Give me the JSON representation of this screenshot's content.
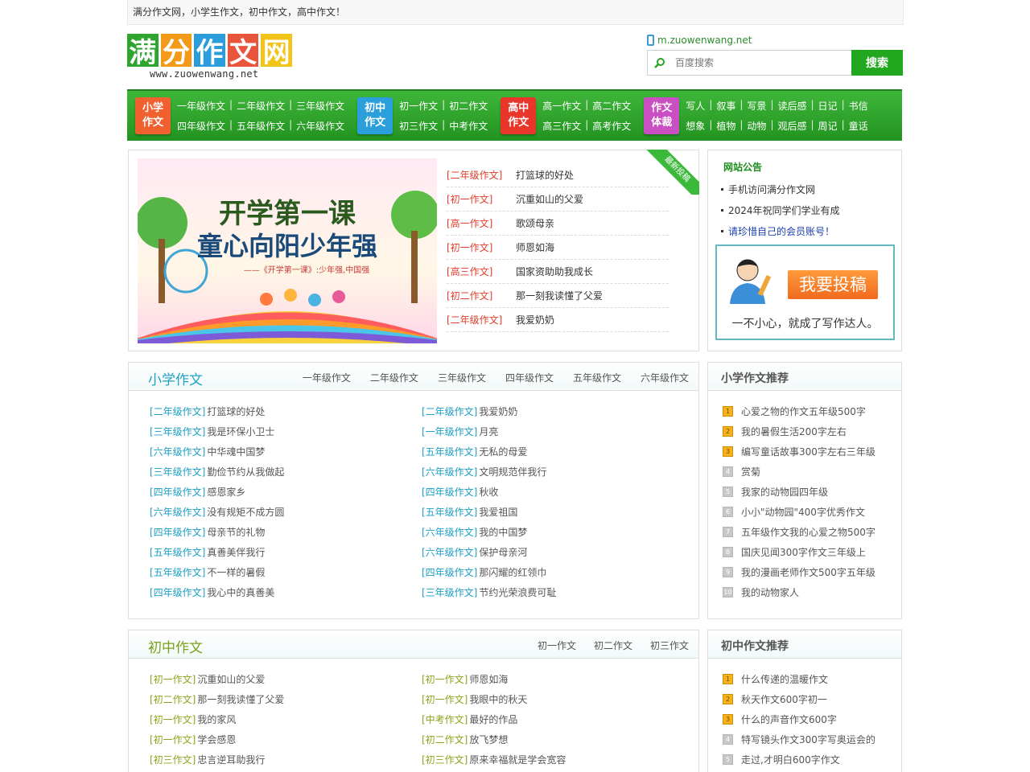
{
  "topbar": {
    "text": "满分作文网，小学生作文，初中作文，高中作文！"
  },
  "logo": {
    "chars": [
      "满",
      "分",
      "作",
      "文",
      "网"
    ],
    "colors": [
      "#2fa52f",
      "#f39a1b",
      "#2c9ddb",
      "#e9553a",
      "#f2c318"
    ],
    "url": "www.zuowenwang.net"
  },
  "header": {
    "mobile_link": "m.zuowenwang.net",
    "search_placeholder": "百度搜索",
    "search_button": "搜索"
  },
  "nav": [
    {
      "badge": [
        "小学",
        "作文"
      ],
      "color": "#f0612f",
      "rows": [
        [
          "一年级作文",
          "二年级作文",
          "三年级作文"
        ],
        [
          "四年级作文",
          "五年级作文",
          "六年级作文"
        ]
      ]
    },
    {
      "badge": [
        "初中",
        "作文"
      ],
      "color": "#2a9fdc",
      "rows": [
        [
          "初一作文",
          "初二作文"
        ],
        [
          "初三作文",
          "中考作文"
        ]
      ]
    },
    {
      "badge": [
        "高中",
        "作文"
      ],
      "color": "#e8362b",
      "rows": [
        [
          "高一作文",
          "高二作文"
        ],
        [
          "高三作文",
          "高考作文"
        ]
      ]
    },
    {
      "badge": [
        "作文",
        "体裁"
      ],
      "color": "#c94fc2",
      "rows": [
        [
          "写人",
          "叙事",
          "写景",
          "读后感",
          "日记",
          "书信"
        ],
        [
          "想象",
          "植物",
          "动物",
          "观后感",
          "周记",
          "童话"
        ]
      ]
    }
  ],
  "banner": {
    "line1": "开学第一课",
    "line2": "童心向阳少年强",
    "caption": "——《开学第一课》:少年强,中国强"
  },
  "latest": {
    "ribbon": "最新投稿",
    "items": [
      {
        "cat": "[二年级作文]",
        "title": "打篮球的好处"
      },
      {
        "cat": "[初一作文]",
        "title": "沉重如山的父爱"
      },
      {
        "cat": "[高一作文]",
        "title": "歌颂母亲"
      },
      {
        "cat": "[初一作文]",
        "title": "师恩如海"
      },
      {
        "cat": "[高三作文]",
        "title": "国家资助助我成长"
      },
      {
        "cat": "[初二作文]",
        "title": "那一刻我读懂了父爱"
      },
      {
        "cat": "[二年级作文]",
        "title": "我爱奶奶"
      }
    ]
  },
  "notice": {
    "title": "网站公告",
    "items": [
      "手机访问满分作文网",
      "2024年祝同学们学业有成",
      "请珍惜自己的会员账号！"
    ]
  },
  "submit": {
    "button": "我要投稿",
    "slogan": "一不小心，就成了写作达人。"
  },
  "primary": {
    "title": "小学作文",
    "tabs": [
      "一年级作文",
      "二年级作文",
      "三年级作文",
      "四年级作文",
      "五年级作文",
      "六年级作文"
    ],
    "left": [
      {
        "cat": "[二年级作文]",
        "title": "打篮球的好处"
      },
      {
        "cat": "[三年级作文]",
        "title": "我是环保小卫士"
      },
      {
        "cat": "[六年级作文]",
        "title": "中华魂中国梦"
      },
      {
        "cat": "[三年级作文]",
        "title": "勤俭节约从我做起"
      },
      {
        "cat": "[四年级作文]",
        "title": "感恩家乡"
      },
      {
        "cat": "[六年级作文]",
        "title": "没有规矩不成方圆"
      },
      {
        "cat": "[四年级作文]",
        "title": "母亲节的礼物"
      },
      {
        "cat": "[五年级作文]",
        "title": "真善美伴我行"
      },
      {
        "cat": "[五年级作文]",
        "title": "不一样的暑假"
      },
      {
        "cat": "[四年级作文]",
        "title": "我心中的真善美"
      }
    ],
    "right": [
      {
        "cat": "[二年级作文]",
        "title": "我爱奶奶"
      },
      {
        "cat": "[一年级作文]",
        "title": "月亮"
      },
      {
        "cat": "[五年级作文]",
        "title": "无私的母爱"
      },
      {
        "cat": "[六年级作文]",
        "title": "文明规范伴我行"
      },
      {
        "cat": "[四年级作文]",
        "title": "秋收"
      },
      {
        "cat": "[五年级作文]",
        "title": "我爱祖国"
      },
      {
        "cat": "[六年级作文]",
        "title": "我的中国梦"
      },
      {
        "cat": "[六年级作文]",
        "title": "保护母亲河"
      },
      {
        "cat": "[四年级作文]",
        "title": "那闪耀的红领巾"
      },
      {
        "cat": "[三年级作文]",
        "title": "节约光荣浪费可耻"
      }
    ]
  },
  "primary_rec": {
    "title": "小学作文推荐",
    "items": [
      "心爱之物的作文五年级500字",
      "我的暑假生活200字左右",
      "编写童话故事300字左右三年级",
      "赏菊",
      "我家的动物园四年级",
      "小小\"动物园\"400字优秀作文",
      "五年级作文我的心爱之物500字",
      "国庆见闻300字作文三年级上",
      "我的漫画老师作文500字五年级",
      "我的动物家人"
    ]
  },
  "middle": {
    "title": "初中作文",
    "tabs": [
      "初一作文",
      "初二作文",
      "初三作文"
    ],
    "left": [
      {
        "cat": "[初一作文]",
        "title": "沉重如山的父爱"
      },
      {
        "cat": "[初二作文]",
        "title": "那一刻我读懂了父爱"
      },
      {
        "cat": "[初一作文]",
        "title": "我的家风"
      },
      {
        "cat": "[初一作文]",
        "title": "学会感恩"
      },
      {
        "cat": "[初三作文]",
        "title": "忠言逆耳助我行"
      }
    ],
    "right": [
      {
        "cat": "[初一作文]",
        "title": "师恩如海"
      },
      {
        "cat": "[初一作文]",
        "title": "我眼中的秋天"
      },
      {
        "cat": "[中考作文]",
        "title": "最好的作品"
      },
      {
        "cat": "[初二作文]",
        "title": "放飞梦想"
      },
      {
        "cat": "[初三作文]",
        "title": "原来幸福就是学会宽容"
      }
    ]
  },
  "middle_rec": {
    "title": "初中作文推荐",
    "items": [
      "什么传递的温暖作文",
      "秋天作文600字初一",
      "什么的声音作文600字",
      "特写镜头作文300字写奥运会的",
      "走过,才明白600字作文"
    ]
  }
}
